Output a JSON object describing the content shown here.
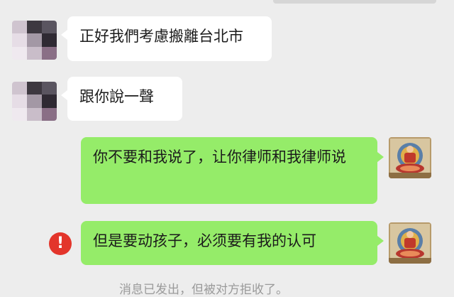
{
  "chat": {
    "messages": [
      {
        "direction": "incoming",
        "text": "正好我們考慮搬離台北市",
        "avatar": "pixelated-contact-avatar"
      },
      {
        "direction": "incoming",
        "text": "跟你說一聲",
        "avatar": "pixelated-contact-avatar"
      },
      {
        "direction": "outgoing",
        "text": "你不要和我说了，让你律师和我律师说",
        "avatar": "thangka-avatar"
      },
      {
        "direction": "outgoing",
        "text": "但是要动孩子，必须要有我的认可",
        "avatar": "thangka-avatar",
        "status": "failed",
        "status_icon": "exclamation-error-icon"
      }
    ],
    "system_notice": "消息已发出，但被对方拒收了。"
  },
  "colors": {
    "background": "#ededed",
    "incoming_bubble": "#ffffff",
    "outgoing_bubble": "#95ec69",
    "error_icon": "#e3352b"
  }
}
